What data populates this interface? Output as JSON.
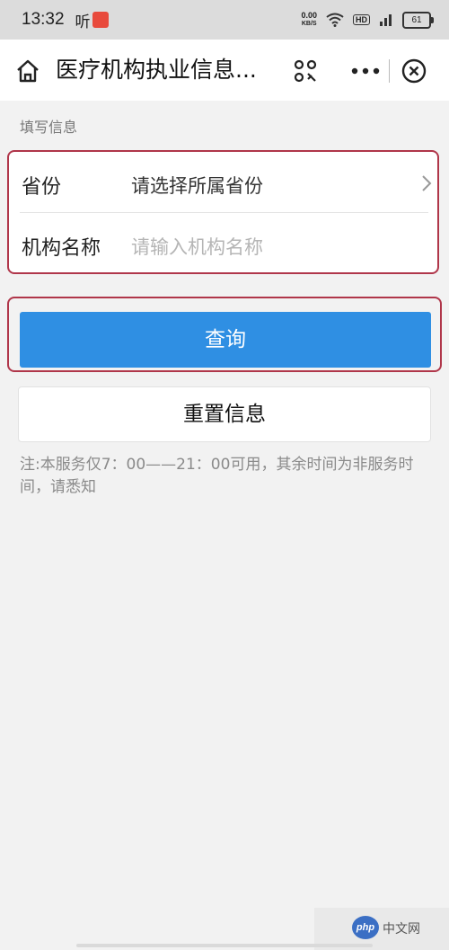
{
  "status_bar": {
    "time": "13:32",
    "app_label": "听",
    "net_speed_value": "0.00",
    "net_speed_unit": "KB/S",
    "hd_label": "HD",
    "battery_level": "61"
  },
  "nav": {
    "title": "医疗机构执业信息..."
  },
  "form": {
    "section_label": "填写信息",
    "province_label": "省份",
    "province_value": "请选择所属省份",
    "institution_label": "机构名称",
    "institution_placeholder": "请输入机构名称"
  },
  "actions": {
    "query_label": "查询",
    "reset_label": "重置信息"
  },
  "notice": "注:本服务仅7：00——21：00可用，其余时间为非服务时间，请悉知",
  "watermark": {
    "logo_text": "php",
    "site_text": "中文网"
  },
  "colors": {
    "primary_button": "#2f8fe3",
    "highlight_border": "#b0364a"
  }
}
